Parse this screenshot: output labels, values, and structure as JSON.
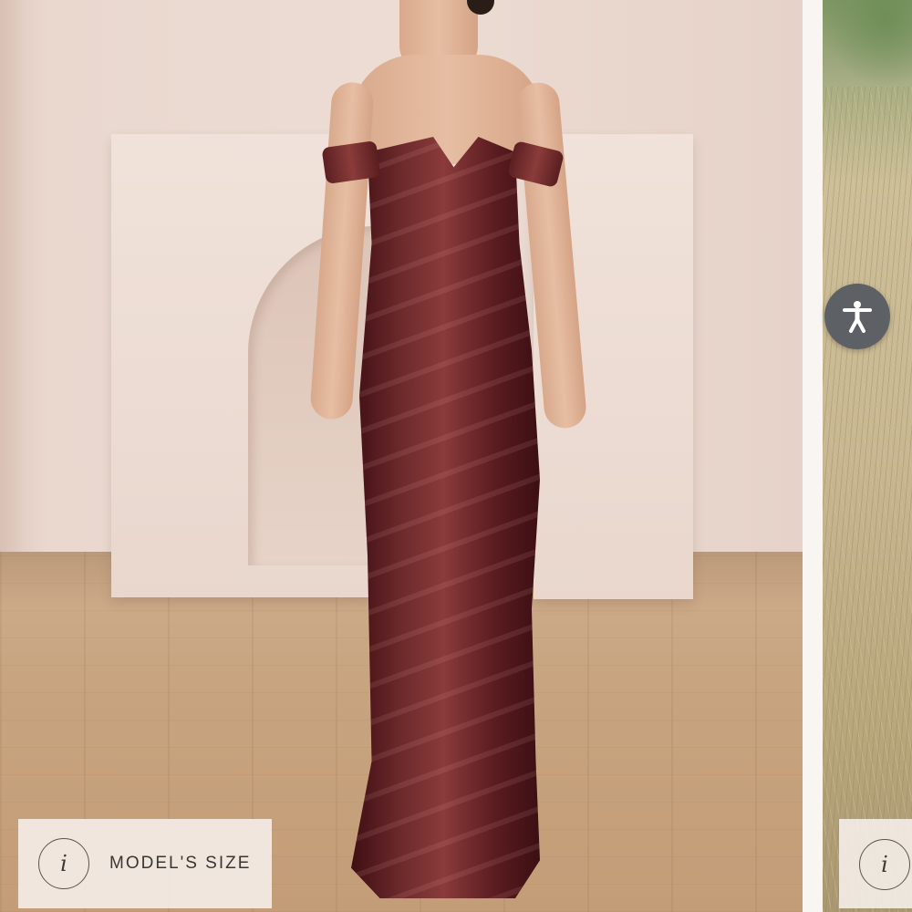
{
  "gallery": {
    "main_slide": {
      "image_alt": "Model wearing off-shoulder velvet gown",
      "size_chip": {
        "info_icon_glyph": "i",
        "label": "MODEL'S SIZE"
      }
    },
    "next_slide": {
      "size_chip": {
        "info_icon_glyph": "i"
      }
    }
  },
  "accessibility": {
    "icon": "accessibility-person-icon",
    "color": "#5d6064"
  },
  "colors": {
    "dress": "#6e2a2c",
    "chip_bg": "#f6f0eb",
    "wall": "#ecdcd3",
    "floor": "#c7a37f"
  }
}
